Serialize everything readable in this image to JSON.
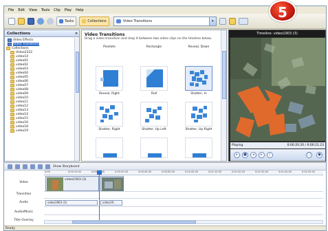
{
  "badge": {
    "number": "5"
  },
  "menu": [
    "File",
    "Edit",
    "View",
    "Tools",
    "Clip",
    "Play",
    "Help"
  ],
  "toolbar": {
    "tasks_label": "Tasks",
    "collections_label": "Collections",
    "combo_value": "Video Transitions"
  },
  "collections": {
    "header": "Collections",
    "items": [
      {
        "label": "Video Effects",
        "kind": "blue"
      },
      {
        "label": "Video Transitions",
        "kind": "blue",
        "selected": true
      },
      {
        "label": "Collections",
        "kind": "folder"
      },
      {
        "label": "Video2222",
        "kind": "folder"
      },
      {
        "label": "video14",
        "kind": "folder"
      },
      {
        "label": "video01",
        "kind": "folder"
      },
      {
        "label": "video02",
        "kind": "folder"
      },
      {
        "label": "video03",
        "kind": "folder"
      },
      {
        "label": "video04",
        "kind": "folder"
      },
      {
        "label": "video05",
        "kind": "folder"
      },
      {
        "label": "video06",
        "kind": "folder"
      },
      {
        "label": "video07",
        "kind": "folder"
      },
      {
        "label": "video08",
        "kind": "folder"
      },
      {
        "label": "video09",
        "kind": "folder"
      },
      {
        "label": "video10",
        "kind": "folder"
      },
      {
        "label": "video11",
        "kind": "folder"
      },
      {
        "label": "video12",
        "kind": "folder"
      },
      {
        "label": "video13",
        "kind": "folder"
      },
      {
        "label": "video14",
        "kind": "folder"
      },
      {
        "label": "video15",
        "kind": "folder"
      },
      {
        "label": "video16",
        "kind": "folder"
      },
      {
        "label": "video18",
        "kind": "folder"
      },
      {
        "label": "video19",
        "kind": "folder"
      }
    ]
  },
  "transitions": {
    "title": "Video Transitions",
    "subtitle": "Drag a video transition and drop it between two video clips on the timeline below.",
    "top_labels": [
      "Pixelate",
      "Rectangle",
      "Reveal, Down"
    ],
    "rows": [
      {
        "labels": [
          "Reveal, Right",
          "Roll",
          "Shatter, In"
        ]
      },
      {
        "labels": [
          "Shatter, Right",
          "Shatter, Up Left",
          "Shatter, Up Right"
        ]
      }
    ]
  },
  "monitor": {
    "title": "Timeline: video1903 (3)",
    "status": "Playing",
    "time": "0:00:20.20 / 0:00:21.23"
  },
  "timeline": {
    "storyboard_label": "Show Storyboard",
    "ticks": [
      "0:00",
      "0:00:10.00",
      "0:00:20.00",
      "0:00:30.00",
      "0:00:40.00",
      "0:00:50.00",
      "0:01:00.00",
      "0:01:10.00",
      "0:01:20.00",
      "0:01:30.00",
      "0:01:40.00",
      "0:01:50.00"
    ],
    "tracks": [
      "Video",
      "Transition",
      "Audio",
      "Audio/Music",
      "Title Overlay"
    ],
    "video_clip_label": "video1903 (3)",
    "audio_clip1": "video1903 (3)",
    "audio_clip2": "video19..."
  },
  "status": "Ready"
}
